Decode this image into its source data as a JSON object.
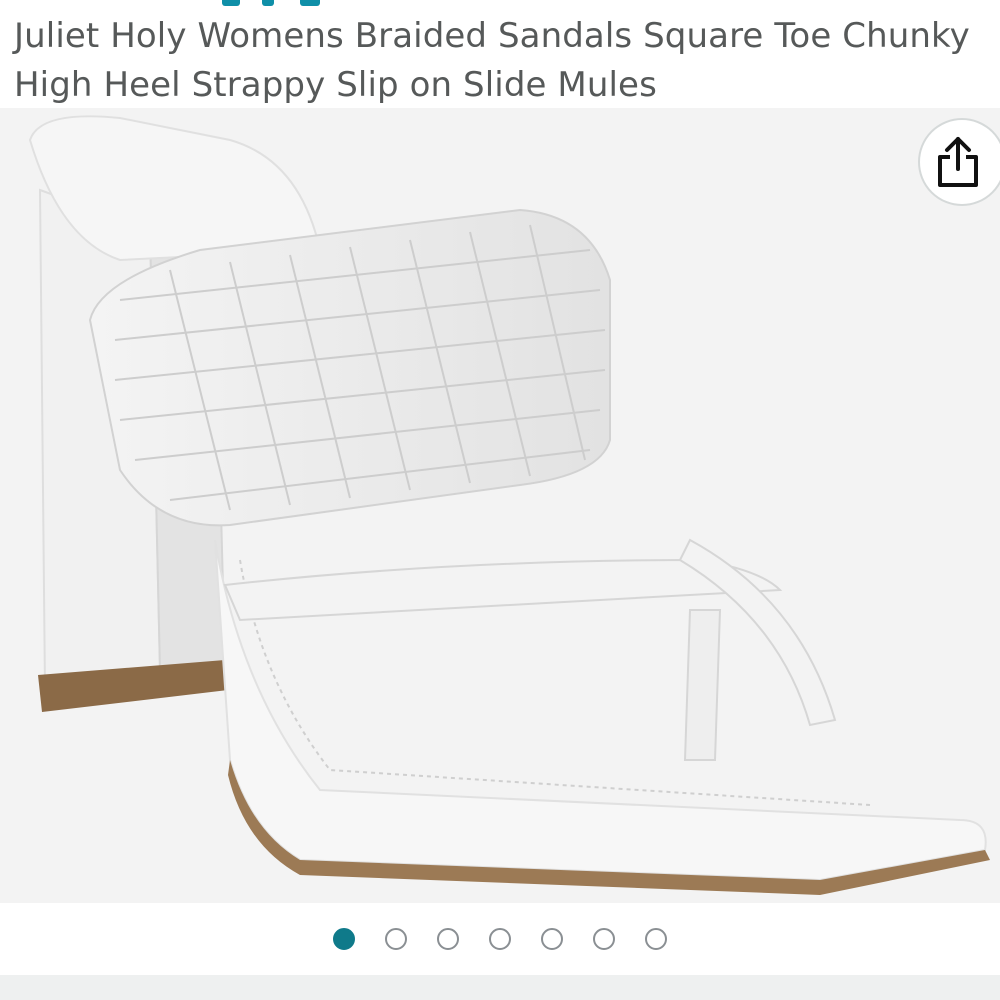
{
  "product": {
    "title_line1": "Juliet Holy Womens Braided Sandals Square Toe Chunky",
    "title_line2": "High Heel Strappy Slip on Slide Mules"
  },
  "image": {
    "icon": "sandal-product-photo",
    "share_icon": "share-icon"
  },
  "gallery": {
    "total_images": 7,
    "active_index": 0
  },
  "colors": {
    "accent": "#0f7a8a",
    "title_text": "#565959"
  }
}
